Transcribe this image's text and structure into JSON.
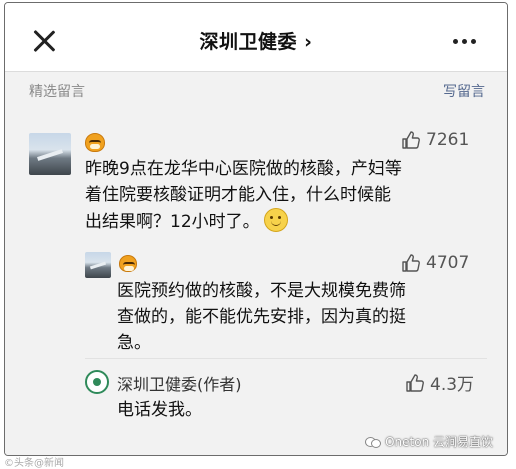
{
  "header": {
    "title": "深圳卫健委 ›"
  },
  "section": {
    "label": "精选留言",
    "write_label": "写留言"
  },
  "comment": {
    "likes": "7261",
    "text_lines": [
      "昨晚9点在龙华中心医院做的核酸，产妇等",
      "着住院要核酸证明才能入住，什么时候能",
      "出结果啊？12小时了。"
    ]
  },
  "reply1": {
    "likes": "4707",
    "text_lines": [
      "医院预约做的核酸，不是大规模免费筛",
      "查做的，能不能优先安排，因为真的挺",
      "急。"
    ]
  },
  "reply2": {
    "author": "深圳卫健委(作者)",
    "likes": "4.3万",
    "text": "电话发我。"
  },
  "watermark": {
    "left": "©头条@新闻",
    "right": "Oneton 云涧易直饮"
  },
  "colors": {
    "link": "#55698f",
    "background": "#f2f2f2",
    "logo_green": "#2f8a5a"
  }
}
